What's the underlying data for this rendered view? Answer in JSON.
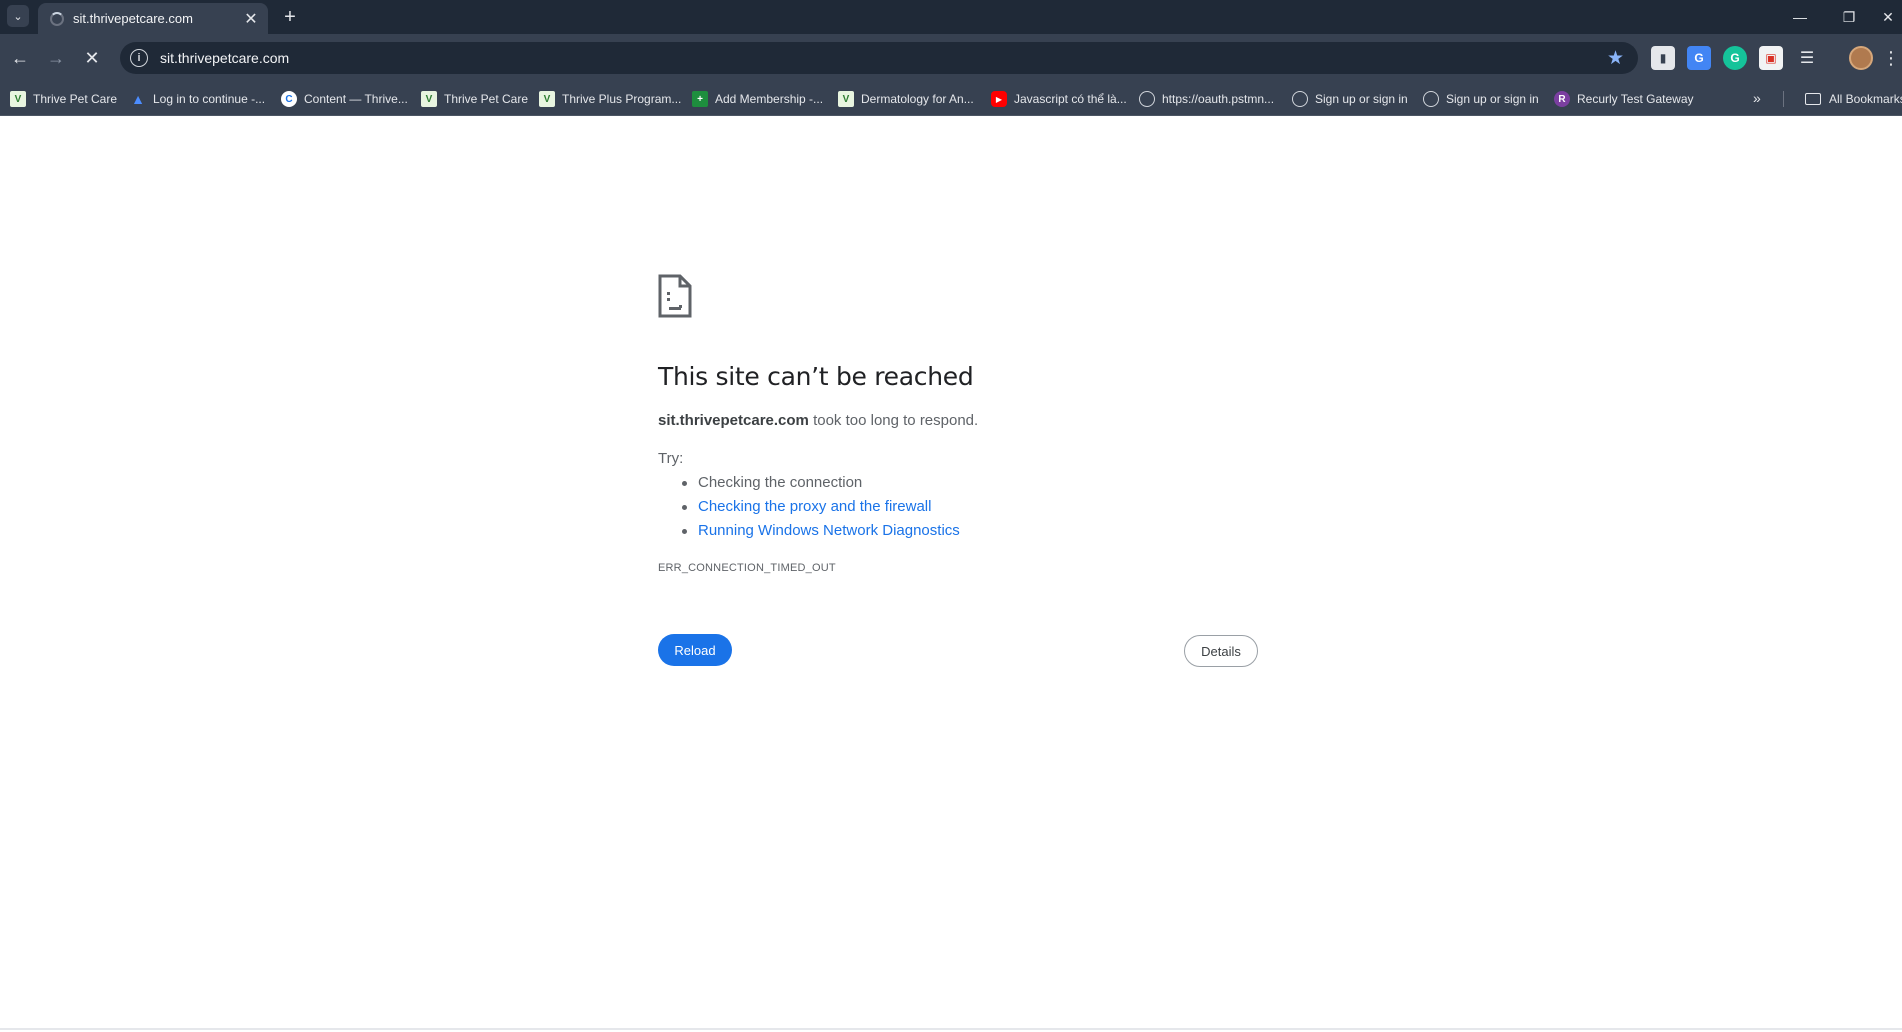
{
  "browser": {
    "tab": {
      "title": "sit.thrivepetcare.com"
    },
    "address_bar": {
      "url": "sit.thrivepetcare.com"
    },
    "bookmarks": [
      {
        "label": "Thrive Pet Care",
        "icon": "thrive-icon"
      },
      {
        "label": "Log in to continue -...",
        "icon": "atlassian-icon"
      },
      {
        "label": "Content — Thrive...",
        "icon": "content-icon"
      },
      {
        "label": "Thrive Pet Care",
        "icon": "thrive-icon"
      },
      {
        "label": "Thrive Plus Program...",
        "icon": "thrive-icon"
      },
      {
        "label": "Add Membership -...",
        "icon": "sheets-icon"
      },
      {
        "label": "Dermatology for An...",
        "icon": "thrive-icon"
      },
      {
        "label": "Javascript có thể là...",
        "icon": "youtube-icon"
      },
      {
        "label": "https://oauth.pstmn...",
        "icon": "globe-icon"
      },
      {
        "label": "Sign up or sign in",
        "icon": "globe-icon"
      },
      {
        "label": "Sign up or sign in",
        "icon": "globe-icon"
      },
      {
        "label": "Recurly Test Gateway",
        "icon": "recurly-icon"
      }
    ],
    "all_bookmarks_label": "All Bookmarks",
    "accent_color": "#8ab4f8"
  },
  "error": {
    "title": "This site can’t be reached",
    "host": "sit.thrivepetcare.com",
    "summary_rest": " took too long to respond.",
    "try_label": "Try:",
    "suggestions": [
      "Checking the connection",
      "Checking the proxy and the firewall",
      "Running Windows Network Diagnostics"
    ],
    "code": "ERR_CONNECTION_TIMED_OUT",
    "reload_label": "Reload",
    "details_label": "Details",
    "button_color": "#1a73e8"
  }
}
